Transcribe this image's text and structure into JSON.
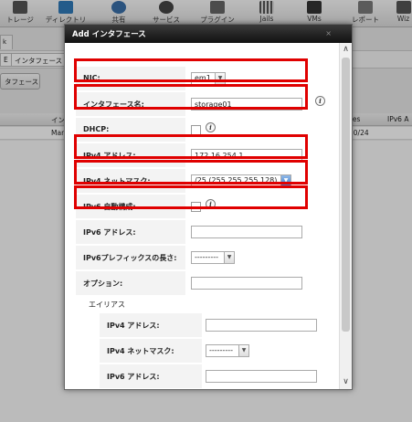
{
  "toolbar": {
    "items": [
      {
        "label": "トレージ",
        "icon": "storage-icon"
      },
      {
        "label": "ディレクトリ",
        "icon": "directory-icon"
      },
      {
        "label": "共有",
        "icon": "sharing-icon"
      },
      {
        "label": "サービス",
        "icon": "services-icon"
      },
      {
        "label": "プラグイン",
        "icon": "plugins-icon"
      },
      {
        "label": "Jails",
        "icon": "jails-icon"
      },
      {
        "label": "VMs",
        "icon": "vms-icon"
      },
      {
        "label": "レポート",
        "icon": "reports-icon"
      },
      {
        "label": "Wiz",
        "icon": "wizard-icon"
      }
    ]
  },
  "background": {
    "tab": "k",
    "subtab_prefix": "E",
    "subtab": "インタフェース",
    "add_button": "タフェース",
    "table_header_col": "イン",
    "table_header_col2": "ses",
    "table_header_col3": "IPv6 A",
    "table_row_cell": "Mar",
    "table_row_cell2": "20/24"
  },
  "dialog": {
    "title": "Add インタフェース",
    "close": "×",
    "fields": {
      "nic": {
        "label": "NIC:",
        "value": "em1"
      },
      "interface_name": {
        "label": "インタフェース名:",
        "value": "storage01"
      },
      "dhcp": {
        "label": "DHCP:",
        "checked": false
      },
      "ipv4_address": {
        "label": "IPv4 アドレス:",
        "value": "172.16.254.1"
      },
      "ipv4_netmask": {
        "label": "IPv4 ネットマスク:",
        "value": "/25 (255.255.255.128)"
      },
      "ipv6_auto": {
        "label": "IPv6 自動構成:",
        "checked": false
      },
      "ipv6_address": {
        "label": "IPv6 アドレス:",
        "value": ""
      },
      "ipv6_prefix": {
        "label": "IPv6プレフィックスの長さ:",
        "value": "---------"
      },
      "options": {
        "label": "オプション:",
        "value": ""
      }
    },
    "alias_section": {
      "title": "エイリアス",
      "ipv4_address": {
        "label": "IPv4 アドレス:",
        "value": ""
      },
      "ipv4_netmask": {
        "label": "IPv4 ネットマスク:",
        "value": "---------"
      },
      "ipv6_address": {
        "label": "IPv6 アドレス:",
        "value": ""
      }
    },
    "info_glyph": "i",
    "highlight_color": "#e00000"
  }
}
